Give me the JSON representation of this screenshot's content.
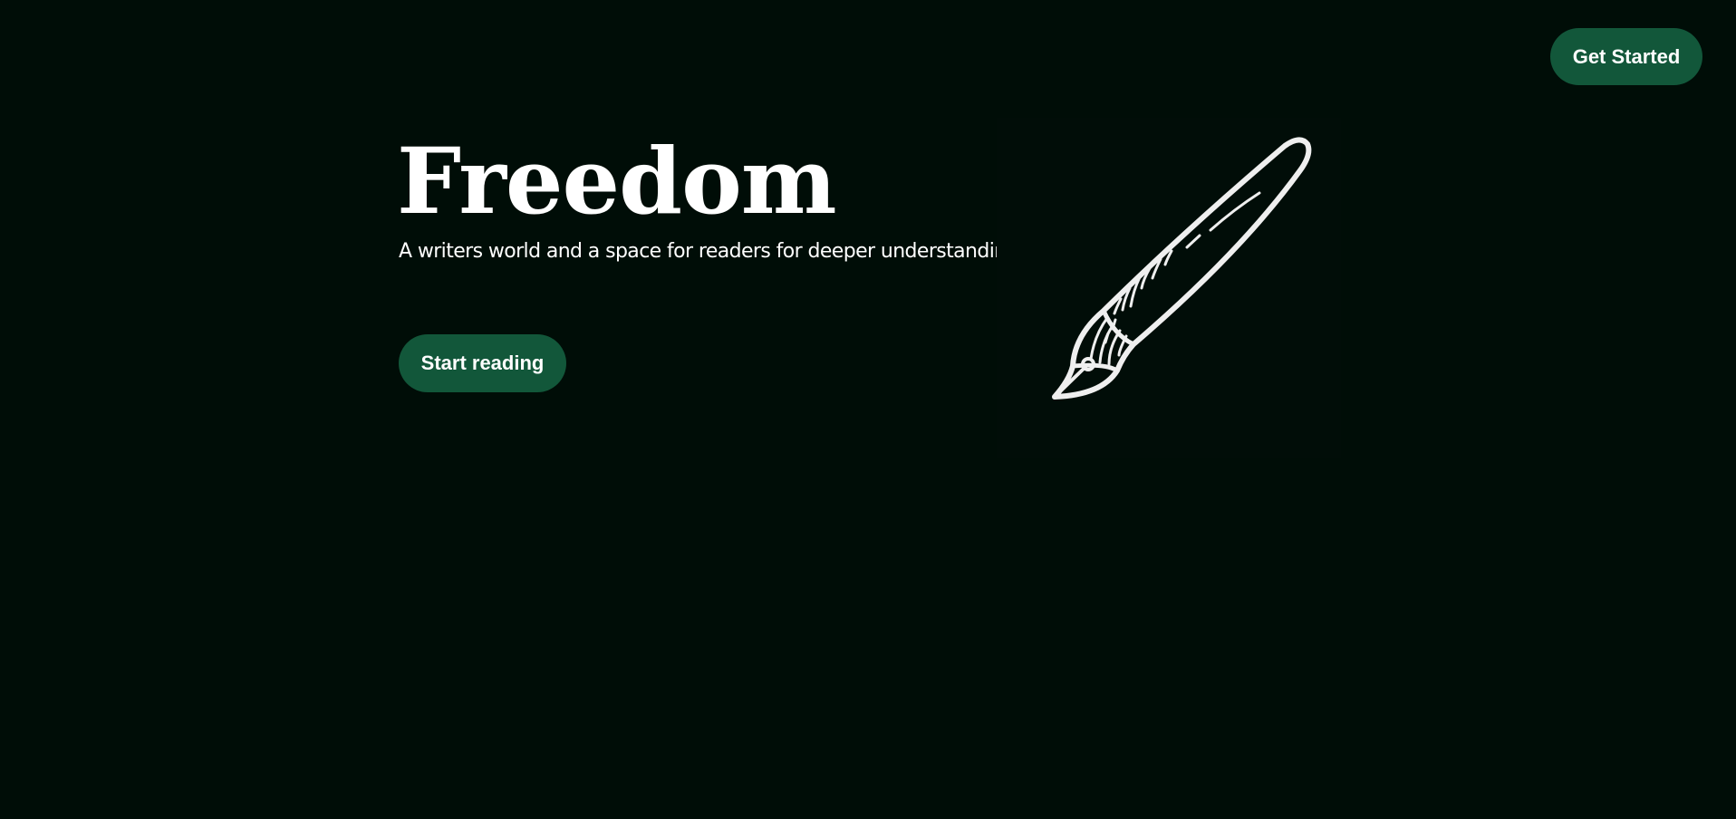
{
  "header": {
    "cta_label": "Get Started"
  },
  "hero": {
    "title": "Freedom",
    "subtitle": "A writers world and a space for readers for deeper understanding.",
    "cta_label": "Start reading",
    "illustration_icon": "fountain-pen-icon"
  },
  "colors": {
    "background": "#000d07",
    "accent": "#12573a",
    "text": "#ffffff"
  }
}
